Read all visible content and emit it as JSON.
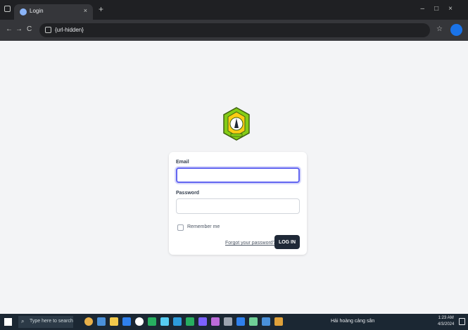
{
  "browser": {
    "tab_title": "Login",
    "tab_close": "×",
    "new_tab": "+",
    "url": "{url-hidden}",
    "nav": {
      "back": "←",
      "forward": "→",
      "reload": "C"
    },
    "star": "☆",
    "window_controls": "–□×"
  },
  "login": {
    "email_label": "Email",
    "email_value": "",
    "password_label": "Password",
    "password_value": "",
    "remember_label": "Remember me",
    "forgot_link": "Forgot your password?",
    "login_button": "LOG IN"
  },
  "taskbar": {
    "search_placeholder": "Type here to search",
    "tray_weather": "Hải hoàng cảng sân",
    "clock_time": "1:23 AM",
    "clock_date": "4/3/2024"
  },
  "colors": {
    "accent": "#6366f1",
    "button": "#1f2937",
    "logo_green": "#84cc16"
  }
}
